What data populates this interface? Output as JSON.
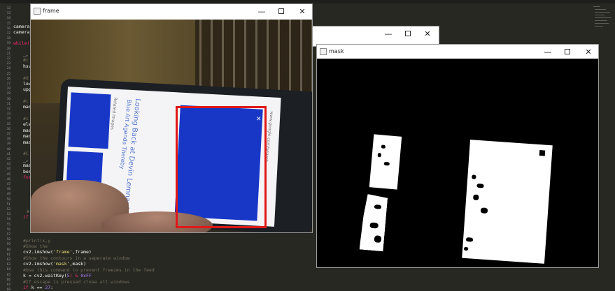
{
  "editor": {
    "line_numbers": [
      "12",
      "13",
      "14",
      "15",
      "16",
      "17",
      "18",
      "19",
      "20",
      "21",
      "22",
      "23",
      "24",
      "25",
      "26",
      "27",
      "28",
      "29",
      "30",
      "31",
      "32",
      "33",
      "34",
      "35",
      "36",
      "37",
      "38",
      "39",
      "40",
      "41",
      "42",
      "43",
      "44",
      "45",
      "46",
      "47",
      "48",
      "49",
      "50",
      "51",
      "52",
      "53",
      "54",
      "55",
      "56",
      "57",
      "58",
      "59",
      "60",
      "61",
      "62",
      "63",
      "64",
      "65",
      "66",
      "67",
      "68"
    ],
    "code_fragments": {
      "camera1": "camera_",
      "camera2": "camera_",
      "while": "while(",
      "l1": "_,",
      "l2": "#c",
      "l3": "hsv",
      "l4": "#d",
      "l5": "low",
      "l6": "upp",
      "l7": "#c",
      "l8": "mas",
      "l9": "#c",
      "l10": "ele",
      "l11": "mas",
      "l12": "mas",
      "l13": "mas",
      "l14": "#C",
      "l15": "_,",
      "l16": "mas",
      "l17": "bes",
      "l18": "for",
      "l19": "#",
      "l20": "if",
      "l21": "cv",
      "print": "#print(x,y",
      "show_the": "#Show the",
      "imshow_frame_a": "cv2.imshow(",
      "imshow_frame_b": "'frame'",
      "imshow_frame_c": ",frame)",
      "comment_contours": "#Show the contours in a seperate window",
      "imshow_mask_a": "cv2.imshow(",
      "imshow_mask_b": "'mask'",
      "imshow_mask_c": ",mask)",
      "comment_freeze": "#Use this command to prevent freezes in the feed",
      "waitkey_a": "k = cv2.waitKey(",
      "waitkey_b": "5",
      "waitkey_c": ") & ",
      "waitkey_d": "0xFF",
      "comment_escape": "#If escape is pressed close all windows",
      "if_k_a": "if",
      "if_k_b": " k == ",
      "if_k_c": "27",
      "if_k_d": ":"
    }
  },
  "windows": {
    "frame": {
      "title": "frame",
      "phone_text": {
        "headline": "Looking Back at Devin Lemnard",
        "subline": "Blue Art Agenda Thereby",
        "url": "www.google.com/search",
        "related": "Related Images"
      }
    },
    "hidden": {
      "title": ""
    },
    "mask": {
      "title": "mask"
    }
  },
  "window_controls": {
    "minimize": "—",
    "close": "✕"
  },
  "colors": {
    "editor_bg": "#272822",
    "detect_box": "#e01818",
    "target_blue": "#1837c7",
    "mask_fg": "#ffffff",
    "mask_bg": "#000000"
  }
}
